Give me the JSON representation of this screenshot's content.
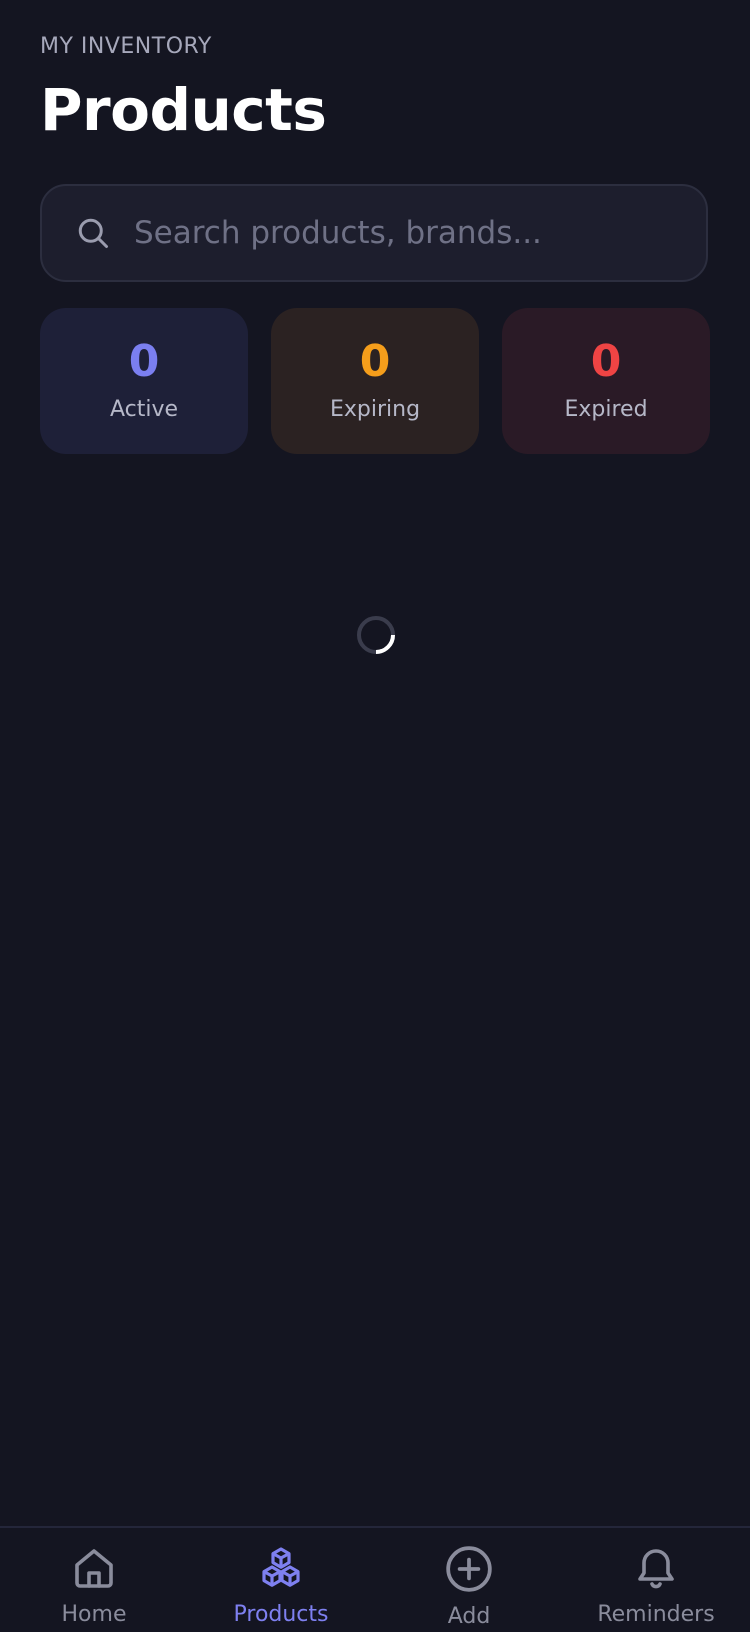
{
  "header": {
    "eyebrow": "MY INVENTORY",
    "title": "Products"
  },
  "search": {
    "placeholder": "Search products, brands...",
    "value": "",
    "icon": "search-icon"
  },
  "stats": [
    {
      "value": "0",
      "label": "Active",
      "color": "#7b7ff0"
    },
    {
      "value": "0",
      "label": "Expiring",
      "color": "#f59e1b"
    },
    {
      "value": "0",
      "label": "Expired",
      "color": "#ef4444"
    }
  ],
  "loading": {
    "state": "loading",
    "icon": "spinner-icon"
  },
  "tabbar": {
    "items": [
      {
        "label": "Home",
        "icon": "home-icon",
        "active": false
      },
      {
        "label": "Products",
        "icon": "cubes-icon",
        "active": true
      },
      {
        "label": "Add",
        "icon": "plus-circle-icon",
        "active": false
      },
      {
        "label": "Reminders",
        "icon": "bell-icon",
        "active": false
      }
    ],
    "active_color": "#7e80f0",
    "inactive_color": "#8a8c9c"
  }
}
